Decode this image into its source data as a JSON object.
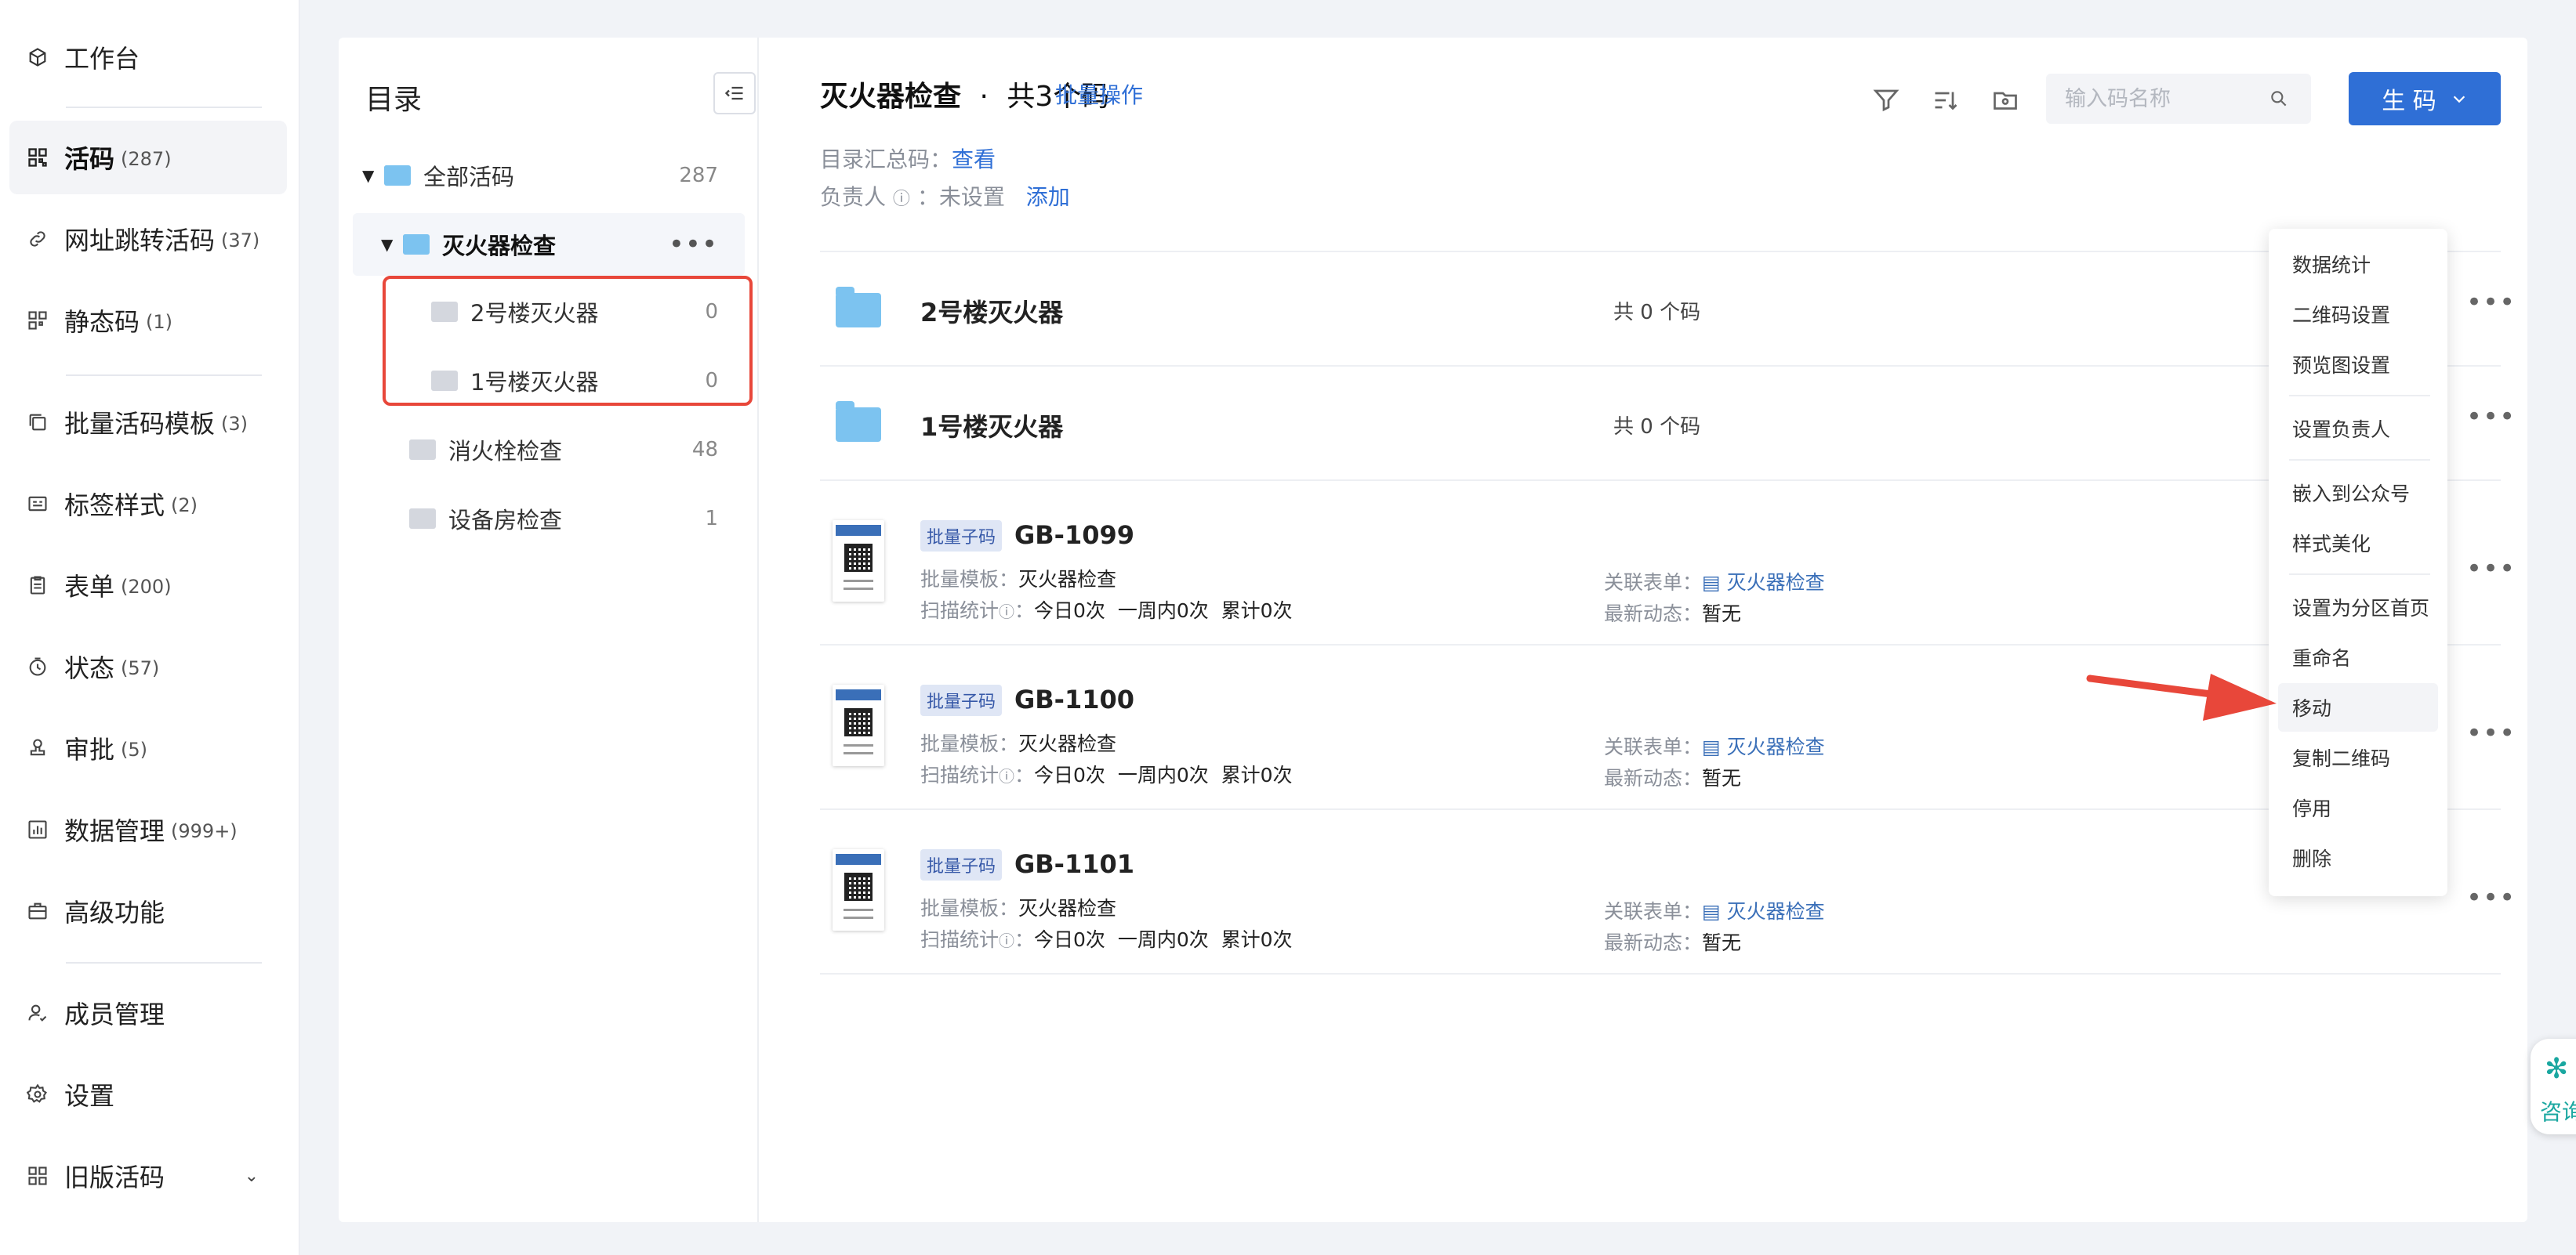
{
  "sidebar": {
    "items": [
      {
        "label": "工作台",
        "count": "",
        "icon": "cube-icon"
      },
      {
        "label": "活码",
        "count": "(287)",
        "icon": "grid-icon",
        "active": true
      },
      {
        "label": "网址跳转活码",
        "count": "(37)",
        "icon": "link-icon"
      },
      {
        "label": "静态码",
        "count": "(1)",
        "icon": "qr-icon"
      },
      {
        "label": "批量活码模板",
        "count": "(3)",
        "icon": "copy-icon"
      },
      {
        "label": "标签样式",
        "count": "(2)",
        "icon": "label-icon"
      },
      {
        "label": "表单",
        "count": "(200)",
        "icon": "clipboard-icon"
      },
      {
        "label": "状态",
        "count": "(57)",
        "icon": "status-icon"
      },
      {
        "label": "审批",
        "count": "(5)",
        "icon": "stamp-icon"
      },
      {
        "label": "数据管理",
        "count": "(999+)",
        "icon": "chart-icon"
      },
      {
        "label": "高级功能",
        "count": "",
        "icon": "briefcase-icon"
      },
      {
        "label": "成员管理",
        "count": "",
        "icon": "user-icon"
      },
      {
        "label": "设置",
        "count": "",
        "icon": "gear-icon"
      },
      {
        "label": "旧版活码",
        "count": "",
        "icon": "grid-icon"
      }
    ]
  },
  "tree": {
    "title": "目录",
    "nodes": [
      {
        "label": "全部活码",
        "count": "287"
      },
      {
        "label": "灭火器检查",
        "count": ""
      },
      {
        "label": "2号楼灭火器",
        "count": "0"
      },
      {
        "label": "1号楼灭火器",
        "count": "0"
      },
      {
        "label": "消火栓检查",
        "count": "48"
      },
      {
        "label": "设备房检查",
        "count": "1"
      }
    ]
  },
  "header": {
    "title": "灭火器检查",
    "separator": "·",
    "total": "共3个码",
    "batch_label": "批量操作",
    "summary_label": "目录汇总码：",
    "summary_link": "查看",
    "owner_label": "负责人",
    "owner_value": "：未设置",
    "owner_add": "添加",
    "search_placeholder": "输入码名称",
    "generate_label": "生 码"
  },
  "folders": [
    {
      "name": "2号楼灭火器",
      "count": "共 0 个码"
    },
    {
      "name": "1号楼灭火器",
      "count": "共 0 个码"
    }
  ],
  "codes": [
    {
      "badge": "批量子码",
      "name": "GB-1099",
      "template_label": "批量模板：",
      "template": "灭火器检查",
      "scan_label": "扫描统计",
      "scan_sep": "：",
      "scan": "今日0次  一周内0次  累计0次",
      "form_label": "关联表单：",
      "form": "灭火器检查",
      "latest_label": "最新动态：",
      "latest": "暂无"
    },
    {
      "badge": "批量子码",
      "name": "GB-1100",
      "template_label": "批量模板：",
      "template": "灭火器检查",
      "scan_label": "扫描统计",
      "scan_sep": "：",
      "scan": "今日0次  一周内0次  累计0次",
      "form_label": "关联表单：",
      "form": "灭火器检查",
      "latest_label": "最新动态：",
      "latest": "暂无"
    },
    {
      "badge": "批量子码",
      "name": "GB-1101",
      "template_label": "批量模板：",
      "template": "灭火器检查",
      "scan_label": "扫描统计",
      "scan_sep": "：",
      "scan": "今日0次  一周内0次  累计0次",
      "form_label": "关联表单：",
      "form": "灭火器检查",
      "latest_label": "最新动态：",
      "latest": "暂无"
    }
  ],
  "menu": {
    "items": [
      "数据统计",
      "二维码设置",
      "预览图设置",
      "设置负责人",
      "嵌入到公众号",
      "样式美化",
      "设置为分区首页",
      "重命名",
      "移动",
      "复制二维码",
      "停用",
      "删除"
    ]
  },
  "consult": {
    "label": "咨询"
  },
  "colors": {
    "accent": "#2f6fd6",
    "highlight": "#e8473a",
    "folder": "#7cc3f0"
  }
}
